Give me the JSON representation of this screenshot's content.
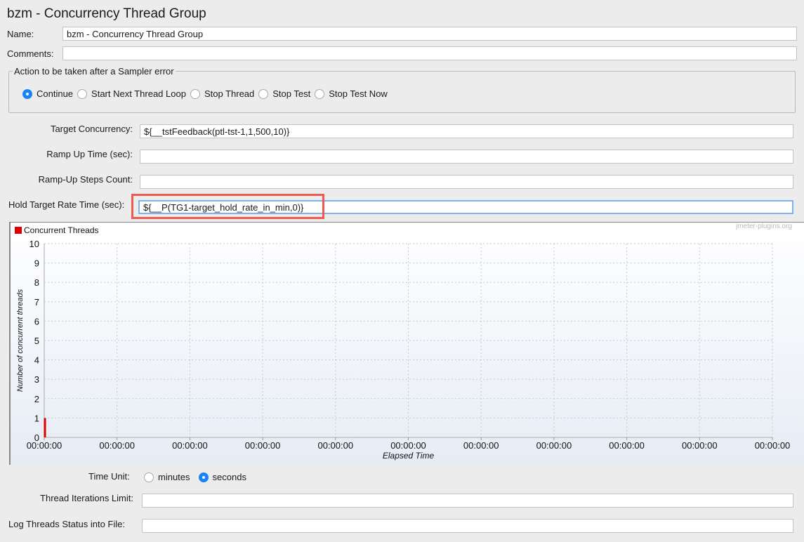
{
  "title": "bzm - Concurrency Thread Group",
  "name": {
    "label": "Name:",
    "value": "bzm - Concurrency Thread Group"
  },
  "comments": {
    "label": "Comments:",
    "value": ""
  },
  "sampler_error": {
    "legend": "Action to be taken after a Sampler error",
    "options": [
      "Continue",
      "Start Next Thread Loop",
      "Stop Thread",
      "Stop Test",
      "Stop Test Now"
    ],
    "selected": "Continue"
  },
  "fields": {
    "target_concurrency": {
      "label": "Target Concurrency:",
      "value": "${__tstFeedback(ptl-tst-1,1,500,10)}"
    },
    "ramp_up_time": {
      "label": "Ramp Up Time (sec):",
      "value": ""
    },
    "ramp_up_steps": {
      "label": "Ramp-Up Steps Count:",
      "value": ""
    },
    "hold_target": {
      "label": "Hold Target Rate Time (sec):",
      "value": "${__P(TG1-target_hold_rate_in_min,0)}"
    }
  },
  "time_unit": {
    "label": "Time Unit:",
    "options": [
      "minutes",
      "seconds"
    ],
    "selected": "seconds"
  },
  "thread_iterations": {
    "label": "Thread Iterations Limit:",
    "value": ""
  },
  "log_threads": {
    "label": "Log Threads Status into File:",
    "value": ""
  },
  "colors": {
    "accent": "#1a82f7",
    "highlight": "#ef5a50",
    "series": "#e00000"
  },
  "chart_data": {
    "type": "line",
    "watermark": "jmeter-plugins.org",
    "xlabel": "Elapsed Time",
    "ylabel": "Number of concurrent threads",
    "x_ticks": [
      "00:00:00",
      "00:00:00",
      "00:00:00",
      "00:00:00",
      "00:00:00",
      "00:00:00",
      "00:00:00",
      "00:00:00",
      "00:00:00",
      "00:00:00",
      "00:00:00"
    ],
    "y_ticks": [
      "0",
      "1",
      "2",
      "3",
      "4",
      "5",
      "6",
      "7",
      "8",
      "9",
      "10"
    ],
    "ylim": [
      0,
      10
    ],
    "grid": true,
    "legend_placement": "top-left",
    "series": [
      {
        "name": "Concurrent Threads",
        "color": "#e00000",
        "points": [
          {
            "x": "00:00:00",
            "y": 0
          },
          {
            "x": "00:00:00",
            "y": 1
          }
        ]
      }
    ]
  }
}
